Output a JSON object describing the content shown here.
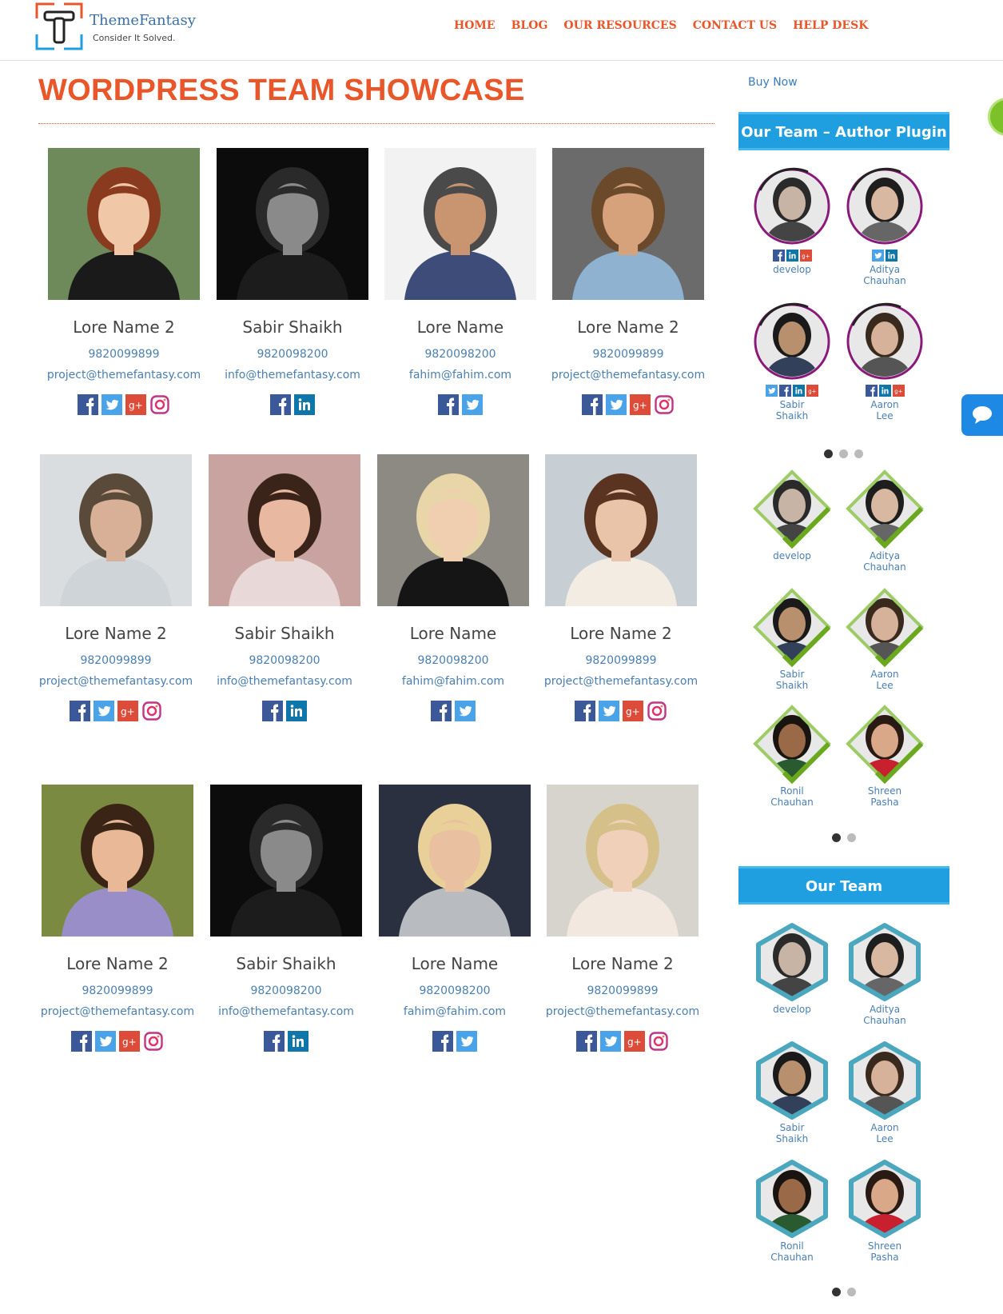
{
  "header": {
    "logo_letter": "T",
    "logo_name": "ThemeFantasy",
    "logo_tagline": "Consider It Solved.",
    "nav": [
      "HOME",
      "BLOG",
      "OUR RESOURCES",
      "CONTACT US",
      "HELP DESK"
    ]
  },
  "colors": {
    "accent": "#e8562a",
    "link": "#4a7fb0",
    "widget": "#1f9ee0",
    "facebook": "#3b5998",
    "twitter": "#4aa3e8",
    "googleplus": "#dd4b39",
    "linkedin": "#0e76a8",
    "instagram": "#c13584"
  },
  "main": {
    "title": "WORDPRESS TEAM SHOWCASE",
    "members": [
      {
        "name": "Lore Name 2",
        "phone": "9820099899",
        "email": "project@themefantasy.com",
        "socials": [
          "facebook-icon",
          "twitter-icon",
          "googleplus-icon",
          "instagram-icon"
        ]
      },
      {
        "name": "Sabir Shaikh",
        "phone": "9820098200",
        "email": "info@themefantasy.com",
        "socials": [
          "facebook-icon",
          "linkedin-icon"
        ]
      },
      {
        "name": "Lore Name",
        "phone": "9820098200",
        "email": "fahim@fahim.com",
        "socials": [
          "facebook-icon",
          "twitter-icon"
        ]
      },
      {
        "name": "Lore Name 2",
        "phone": "9820099899",
        "email": "project@themefantasy.com",
        "socials": [
          "facebook-icon",
          "twitter-icon",
          "googleplus-icon",
          "instagram-icon"
        ]
      },
      {
        "name": "Lore Name 2",
        "phone": "9820099899",
        "email": "project@themefantasy.com",
        "socials": [
          "facebook-icon",
          "twitter-icon",
          "googleplus-icon",
          "instagram-icon"
        ]
      },
      {
        "name": "Sabir Shaikh",
        "phone": "9820098200",
        "email": "info@themefantasy.com",
        "socials": [
          "facebook-icon",
          "linkedin-icon"
        ]
      },
      {
        "name": "Lore Name",
        "phone": "9820098200",
        "email": "fahim@fahim.com",
        "socials": [
          "facebook-icon",
          "twitter-icon"
        ]
      },
      {
        "name": "Lore Name 2",
        "phone": "9820099899",
        "email": "project@themefantasy.com",
        "socials": [
          "facebook-icon",
          "twitter-icon",
          "googleplus-icon",
          "instagram-icon"
        ]
      },
      {
        "name": "Lore Name 2",
        "phone": "9820099899",
        "email": "project@themefantasy.com",
        "socials": [
          "facebook-icon",
          "twitter-icon",
          "googleplus-icon",
          "instagram-icon"
        ]
      },
      {
        "name": "Sabir Shaikh",
        "phone": "9820098200",
        "email": "info@themefantasy.com",
        "socials": [
          "facebook-icon",
          "linkedin-icon"
        ]
      },
      {
        "name": "Lore Name",
        "phone": "9820098200",
        "email": "fahim@fahim.com",
        "socials": [
          "facebook-icon",
          "twitter-icon"
        ]
      },
      {
        "name": "Lore Name 2",
        "phone": "9820099899",
        "email": "project@themefantasy.com",
        "socials": [
          "facebook-icon",
          "twitter-icon",
          "googleplus-icon",
          "instagram-icon"
        ]
      }
    ]
  },
  "sidebar": {
    "buy_now": "Buy Now",
    "widget1": {
      "title": "Our Team – Author Plugin",
      "circle_members": [
        {
          "name_line1": "develop",
          "name_line2": "",
          "socials": [
            "facebook-icon",
            "linkedin-icon",
            "googleplus-icon"
          ]
        },
        {
          "name_line1": "Aditya",
          "name_line2": "Chauhan",
          "socials": [
            "twitter-icon",
            "linkedin-icon"
          ]
        },
        {
          "name_line1": "Sabir",
          "name_line2": "Shaikh",
          "socials": [
            "twitter-icon",
            "facebook-icon",
            "linkedin-icon",
            "googleplus-icon"
          ]
        },
        {
          "name_line1": "Aaron",
          "name_line2": "Lee",
          "socials": [
            "facebook-icon",
            "linkedin-icon",
            "googleplus-icon"
          ]
        }
      ],
      "diamond_members": [
        {
          "name_line1": "develop",
          "name_line2": ""
        },
        {
          "name_line1": "Aditya",
          "name_line2": "Chauhan"
        },
        {
          "name_line1": "Sabir",
          "name_line2": "Shaikh"
        },
        {
          "name_line1": "Aaron",
          "name_line2": "Lee"
        },
        {
          "name_line1": "Ronil",
          "name_line2": "Chauhan"
        },
        {
          "name_line1": "Shreen",
          "name_line2": "Pasha"
        }
      ]
    },
    "widget2": {
      "title": "Our Team",
      "hex_members": [
        {
          "name_line1": "develop",
          "name_line2": ""
        },
        {
          "name_line1": "Aditya",
          "name_line2": "Chauhan"
        },
        {
          "name_line1": "Sabir",
          "name_line2": "Shaikh"
        },
        {
          "name_line1": "Aaron",
          "name_line2": "Lee"
        },
        {
          "name_line1": "Ronil",
          "name_line2": "Chauhan"
        },
        {
          "name_line1": "Shreen",
          "name_line2": "Pasha"
        }
      ]
    }
  }
}
